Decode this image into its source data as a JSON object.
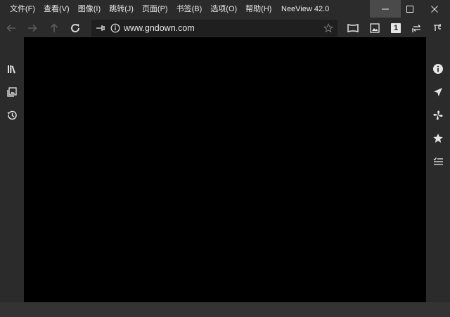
{
  "menu": [
    {
      "id": "file",
      "label": "文件(F)"
    },
    {
      "id": "view",
      "label": "查看(V)"
    },
    {
      "id": "image",
      "label": "图像(I)"
    },
    {
      "id": "jump",
      "label": "跳转(J)"
    },
    {
      "id": "page",
      "label": "页面(P)"
    },
    {
      "id": "bookmark",
      "label": "书签(B)"
    },
    {
      "id": "options",
      "label": "选项(O)"
    },
    {
      "id": "help",
      "label": "帮助(H)"
    }
  ],
  "window": {
    "title": "NeeView 42.0"
  },
  "address": {
    "url": "www.gndown.com"
  },
  "toolbar": {
    "page_mode": "1"
  },
  "icons": {
    "nav": [
      "back-arrow-icon",
      "forward-arrow-icon",
      "up-arrow-icon",
      "refresh-icon"
    ],
    "tools": [
      "stretch-window-icon",
      "image-icon",
      "single-page-icon",
      "swap-direction-icon",
      "pin-toggle-icon"
    ],
    "left_panel": [
      "bookshelf-icon",
      "page-list-icon",
      "history-icon"
    ],
    "right_panel": [
      "information-icon",
      "navigator-icon",
      "effect-icon",
      "bookmark-star-icon",
      "page-marker-icon"
    ]
  },
  "colors": {
    "background": "#2b2b2b",
    "viewer": "#000000",
    "statusbar": "#333333",
    "accent_min_button": "#4a4a4a"
  }
}
